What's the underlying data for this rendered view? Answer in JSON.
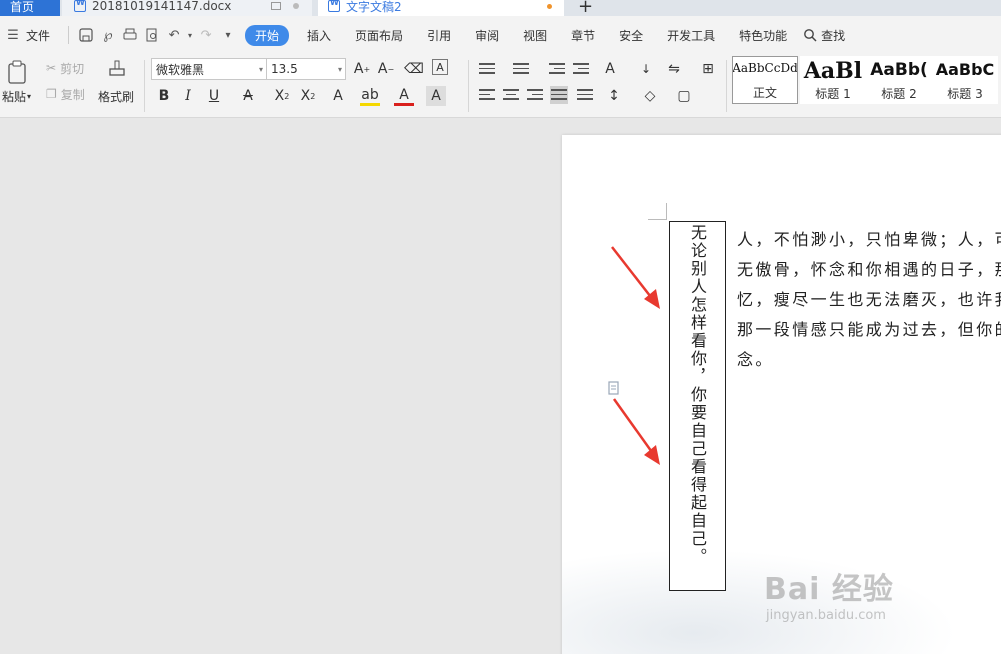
{
  "tabs": [
    {
      "label": "首页"
    },
    {
      "label": "20181019141147.docx"
    },
    {
      "label": "文字文稿2"
    }
  ],
  "menu": {
    "file": "文件",
    "items": [
      "开始",
      "插入",
      "页面布局",
      "引用",
      "审阅",
      "视图",
      "章节",
      "安全",
      "开发工具",
      "特色功能"
    ],
    "search": "查找"
  },
  "ribbon": {
    "paste": "粘贴",
    "cut": "剪切",
    "copy": "复制",
    "format_painter": "格式刷",
    "font_name": "微软雅黑",
    "font_size": "13.5",
    "styles": [
      {
        "sample": "AaBbCcDd",
        "name": "正文"
      },
      {
        "sample": "AaBl",
        "name": "标题 1"
      },
      {
        "sample": "AaBb(",
        "name": "标题 2"
      },
      {
        "sample": "AaBbC",
        "name": "标题 3"
      }
    ]
  },
  "document": {
    "textbox_text": "无论别人怎样看你，你要自己看得起自己。",
    "body_lines": [
      "人，不怕渺小，只怕卑微；人，可",
      "无傲骨，怀念和你相遇的日子，那",
      "忆，瘦尽一生也无法磨灭，也许我",
      "那一段情感只能成为过去，但你的",
      "念。"
    ]
  },
  "watermark": {
    "main": "Bai  经验",
    "sub": "jingyan.baidu.com"
  },
  "colors": {
    "accent": "#3f8ae9",
    "arrow": "#e8392f"
  }
}
